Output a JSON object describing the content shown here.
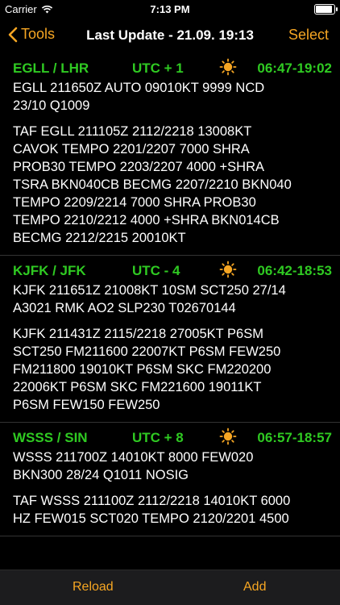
{
  "status_bar": {
    "carrier": "Carrier",
    "time": "7:13 PM",
    "battery_level": 0.95
  },
  "nav": {
    "back_label": "Tools",
    "title": "Last Update - 21.09. 19:13",
    "select_label": "Select"
  },
  "stations": [
    {
      "station": "EGLL / LHR",
      "utc": "UTC + 1",
      "daylight": "06:47-19:02",
      "metar": "EGLL 211650Z AUTO 09010KT 9999 NCD\n23/10 Q1009",
      "taf": "TAF EGLL 211105Z 2112/2218 13008KT\nCAVOK TEMPO 2201/2207 7000 SHRA\nPROB30 TEMPO 2203/2207 4000 +SHRA\nTSRA BKN040CB BECMG 2207/2210 BKN040\nTEMPO 2209/2214 7000 SHRA PROB30\nTEMPO 2210/2212 4000 +SHRA BKN014CB\nBECMG 2212/2215 20010KT"
    },
    {
      "station": "KJFK / JFK",
      "utc": "UTC - 4",
      "daylight": "06:42-18:53",
      "metar": "KJFK 211651Z 21008KT 10SM SCT250 27/14\nA3021 RMK AO2 SLP230 T02670144",
      "taf": "KJFK 211431Z 2115/2218 27005KT P6SM\nSCT250 FM211600 22007KT P6SM FEW250\nFM211800 19010KT P6SM SKC FM220200\n22006KT P6SM SKC FM221600 19011KT\nP6SM FEW150 FEW250"
    },
    {
      "station": "WSSS / SIN",
      "utc": "UTC + 8",
      "daylight": "06:57-18:57",
      "metar": "WSSS 211700Z 14010KT 8000 FEW020\nBKN300 28/24 Q1011 NOSIG",
      "taf": "TAF WSSS 211100Z 2112/2218 14010KT 6000\nHZ FEW015 SCT020 TEMPO 2120/2201 4500"
    }
  ],
  "toolbar": {
    "reload_label": "Reload",
    "add_label": "Add"
  },
  "colors": {
    "accent": "#f6a623",
    "station_green": "#2fca22",
    "sun": "#f6a623"
  },
  "icons": {
    "back": "chevron-left-icon",
    "sun": "sun-icon",
    "wifi": "wifi-icon",
    "battery": "battery-icon"
  }
}
